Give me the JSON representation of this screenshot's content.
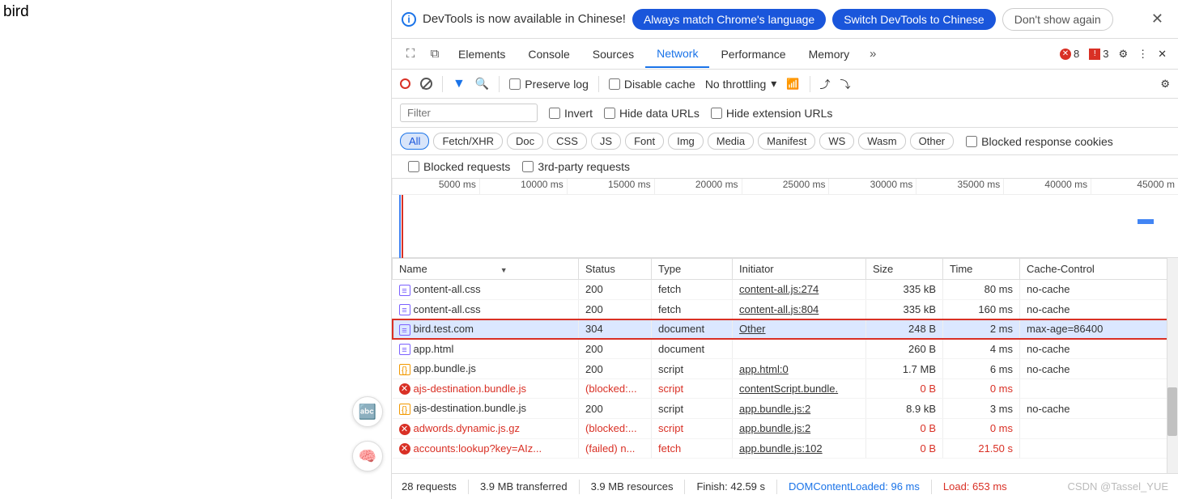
{
  "page": {
    "text": "bird"
  },
  "banner": {
    "message": "DevTools is now available in Chinese!",
    "btn_match": "Always match Chrome's language",
    "btn_switch": "Switch DevTools to Chinese",
    "btn_dont": "Don't show again"
  },
  "tabs": {
    "items": [
      "Elements",
      "Console",
      "Sources",
      "Network",
      "Performance",
      "Memory"
    ],
    "active": "Network",
    "errors": "8",
    "warnings": "3"
  },
  "toolbar": {
    "preserve": "Preserve log",
    "disable_cache": "Disable cache",
    "throttling": "No throttling"
  },
  "filter": {
    "placeholder": "Filter",
    "invert": "Invert",
    "hide_data": "Hide data URLs",
    "hide_ext": "Hide extension URLs"
  },
  "chips": {
    "items": [
      "All",
      "Fetch/XHR",
      "Doc",
      "CSS",
      "JS",
      "Font",
      "Img",
      "Media",
      "Manifest",
      "WS",
      "Wasm",
      "Other"
    ],
    "active": "All",
    "blocked_resp": "Blocked response cookies",
    "blocked_req": "Blocked requests",
    "third_party": "3rd-party requests"
  },
  "timeline": {
    "ticks": [
      "5000 ms",
      "10000 ms",
      "15000 ms",
      "20000 ms",
      "25000 ms",
      "30000 ms",
      "35000 ms",
      "40000 ms",
      "45000 m"
    ]
  },
  "headers": [
    "Name",
    "Status",
    "Type",
    "Initiator",
    "Size",
    "Time",
    "Cache-Control"
  ],
  "rows": [
    {
      "icon": "doc",
      "name": "content-all.css",
      "status": "200",
      "type": "fetch",
      "initiator": "content-all.js:274",
      "size": "335 kB",
      "time": "80 ms",
      "cache": "no-cache",
      "err": false,
      "hl": false
    },
    {
      "icon": "doc",
      "name": "content-all.css",
      "status": "200",
      "type": "fetch",
      "initiator": "content-all.js:804",
      "size": "335 kB",
      "time": "160 ms",
      "cache": "no-cache",
      "err": false,
      "hl": false
    },
    {
      "icon": "doc",
      "name": "bird.test.com",
      "status": "304",
      "type": "document",
      "initiator": "Other",
      "size": "248 B",
      "time": "2 ms",
      "cache": "max-age=86400",
      "err": false,
      "hl": true
    },
    {
      "icon": "doc",
      "name": "app.html",
      "status": "200",
      "type": "document",
      "initiator": "",
      "size": "260 B",
      "time": "4 ms",
      "cache": "no-cache",
      "err": false,
      "hl": false
    },
    {
      "icon": "js",
      "name": "app.bundle.js",
      "status": "200",
      "type": "script",
      "initiator": "app.html:0",
      "size": "1.7 MB",
      "time": "6 ms",
      "cache": "no-cache",
      "err": false,
      "hl": false
    },
    {
      "icon": "err",
      "name": "ajs-destination.bundle.js",
      "status": "(blocked:...",
      "type": "script",
      "initiator": "contentScript.bundle.",
      "size": "0 B",
      "time": "0 ms",
      "cache": "",
      "err": true,
      "hl": false
    },
    {
      "icon": "js",
      "name": "ajs-destination.bundle.js",
      "status": "200",
      "type": "script",
      "initiator": "app.bundle.js:2",
      "size": "8.9 kB",
      "time": "3 ms",
      "cache": "no-cache",
      "err": false,
      "hl": false
    },
    {
      "icon": "err",
      "name": "adwords.dynamic.js.gz",
      "status": "(blocked:...",
      "type": "script",
      "initiator": "app.bundle.js:2",
      "size": "0 B",
      "time": "0 ms",
      "cache": "",
      "err": true,
      "hl": false
    },
    {
      "icon": "err",
      "name": "accounts:lookup?key=AIz...",
      "status": "(failed) n...",
      "type": "fetch",
      "initiator": "app.bundle.js:102",
      "size": "0 B",
      "time": "21.50 s",
      "cache": "",
      "err": true,
      "hl": false
    }
  ],
  "status": {
    "requests": "28 requests",
    "transferred": "3.9 MB transferred",
    "resources": "3.9 MB resources",
    "finish": "Finish: 42.59 s",
    "dcl": "DOMContentLoaded: 96 ms",
    "load": "Load: 653 ms",
    "watermark": "CSDN @Tassel_YUE"
  }
}
